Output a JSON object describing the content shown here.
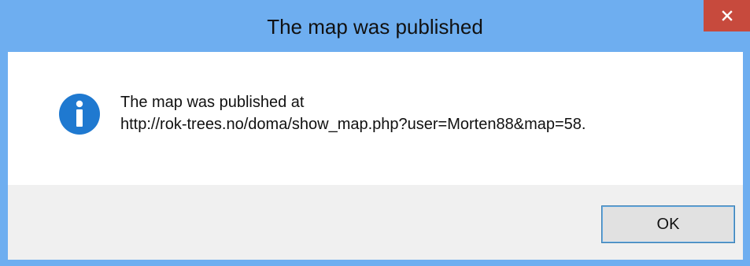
{
  "window": {
    "title": "The map was published",
    "close_icon": "close-icon",
    "accent_color": "#6eaef0",
    "close_color": "#c74a3d"
  },
  "dialog": {
    "icon": "info-icon",
    "message_line1": "The map was published at",
    "message_line2": "http://rok-trees.no/doma/show_map.php?user=Morten88&map=58."
  },
  "buttons": {
    "ok_label": "OK"
  }
}
